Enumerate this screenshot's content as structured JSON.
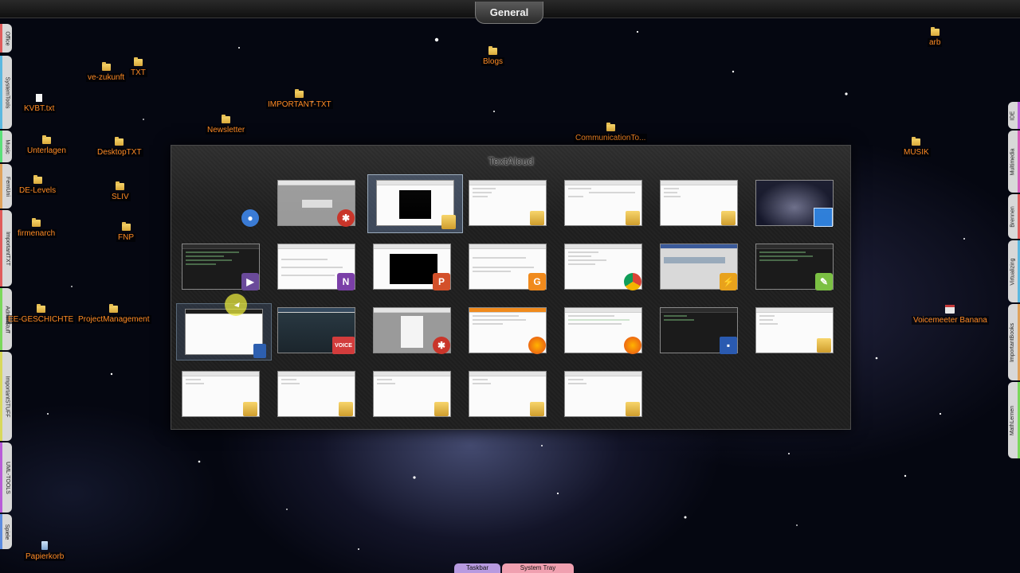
{
  "top_tab": {
    "label": "General"
  },
  "left_tabs": [
    "Office",
    "SystemTools",
    "Music",
    "FernUni",
    "ImportantTXT",
    "AdminStuff",
    "ImportantSTUFF",
    "UML-TOOLS",
    "Spiele"
  ],
  "right_tabs": [
    "IDE",
    "Multimedia",
    "Brennen",
    "Virtualizing",
    "ImportantBooks",
    "MathLernen"
  ],
  "desktop_icons": [
    {
      "label": "ve-zukunft",
      "kind": "folder"
    },
    {
      "label": "TXT",
      "kind": "folder"
    },
    {
      "label": "Blogs",
      "kind": "folder"
    },
    {
      "label": "arb",
      "kind": "folder"
    },
    {
      "label": "KVBT.txt",
      "kind": "doc"
    },
    {
      "label": "IMPORTANT-TXT",
      "kind": "folder"
    },
    {
      "label": "Newsletter",
      "kind": "folder"
    },
    {
      "label": "Unterlagen",
      "kind": "folder"
    },
    {
      "label": "DesktopTXT",
      "kind": "folder"
    },
    {
      "label": "CommunicationTo...",
      "kind": "folder"
    },
    {
      "label": "MUSIK",
      "kind": "folder"
    },
    {
      "label": "DE-Levels",
      "kind": "folder"
    },
    {
      "label": "SLIV",
      "kind": "folder"
    },
    {
      "label": "firmenarch",
      "kind": "folder"
    },
    {
      "label": "FNP",
      "kind": "folder"
    },
    {
      "label": "EE-GESCHICHTE",
      "kind": "folder"
    },
    {
      "label": "ProjectManagement",
      "kind": "folder"
    },
    {
      "label": "Voicemeeter Banana",
      "kind": "app"
    },
    {
      "label": "Papierkorb",
      "kind": "bin"
    }
  ],
  "switcher": {
    "title": "TextAloud",
    "windows": [
      {
        "app": "meet-now-icon",
        "content": "none"
      },
      {
        "app": "irfanview-icon",
        "content": "gray"
      },
      {
        "app": "folder-icon",
        "content": "light",
        "selected": true
      },
      {
        "app": "folder-icon",
        "content": "light"
      },
      {
        "app": "folder-icon",
        "content": "light"
      },
      {
        "app": "folder-icon",
        "content": "light"
      },
      {
        "app": "remote-desktop-icon",
        "content": "space"
      },
      {
        "app": "mpc-icon",
        "content": "dark"
      },
      {
        "app": "onenote-icon",
        "content": "light"
      },
      {
        "app": "powerpoint-icon",
        "content": "light"
      },
      {
        "app": "pdf-reader-icon",
        "content": "light"
      },
      {
        "app": "chrome-icon",
        "content": "light"
      },
      {
        "app": "textaloud-icon",
        "content": "gray"
      },
      {
        "app": "notepad-plus-icon",
        "content": "dark"
      },
      {
        "app": "document-icon",
        "content": "light",
        "hovered": true
      },
      {
        "app": "voicemeeter-icon",
        "content": "audio"
      },
      {
        "app": "irfanview-icon",
        "content": "light"
      },
      {
        "app": "firefox-icon",
        "content": "light"
      },
      {
        "app": "firefox-icon",
        "content": "light"
      },
      {
        "app": "save-icon",
        "content": "dark"
      },
      {
        "app": "folder-icon",
        "content": "light"
      },
      {
        "app": "folder-icon",
        "content": "light"
      },
      {
        "app": "folder-icon",
        "content": "light"
      },
      {
        "app": "folder-icon",
        "content": "light"
      },
      {
        "app": "folder-icon",
        "content": "light"
      },
      {
        "app": "folder-icon",
        "content": "light"
      }
    ]
  },
  "bottom_tabs": [
    "Taskbar",
    "System Tray"
  ],
  "colors": {
    "label_text": "#ff8a24",
    "accent_purple": "#b85bd8",
    "accent_red": "#e05b5b"
  }
}
